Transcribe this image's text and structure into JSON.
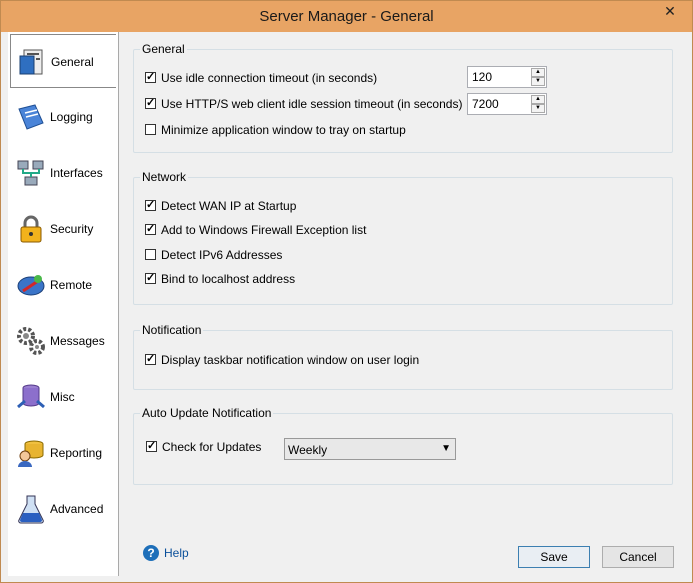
{
  "window": {
    "title": "Server Manager - General",
    "close_glyph": "✕"
  },
  "sidebar": {
    "items": [
      {
        "label": "General",
        "icon": "general-icon"
      },
      {
        "label": "Logging",
        "icon": "logging-icon"
      },
      {
        "label": "Interfaces",
        "icon": "interfaces-icon"
      },
      {
        "label": "Security",
        "icon": "lock-icon"
      },
      {
        "label": "Remote",
        "icon": "remote-icon"
      },
      {
        "label": "Messages",
        "icon": "gears-icon"
      },
      {
        "label": "Misc",
        "icon": "misc-icon"
      },
      {
        "label": "Reporting",
        "icon": "reporting-icon"
      },
      {
        "label": "Advanced",
        "icon": "flask-icon"
      }
    ],
    "active": "General"
  },
  "general": {
    "title": "General",
    "idle_timeout": {
      "label": "Use idle connection timeout (in seconds)",
      "checked": true,
      "value": "120"
    },
    "web_timeout": {
      "label": "Use HTTP/S web client idle session timeout (in seconds)",
      "checked": true,
      "value": "7200"
    },
    "minimize_tray": {
      "label": "Minimize application window to tray on startup",
      "checked": false
    }
  },
  "network": {
    "title": "Network",
    "items": [
      {
        "label": "Detect WAN IP at Startup",
        "checked": true
      },
      {
        "label": "Add to Windows Firewall Exception list",
        "checked": true
      },
      {
        "label": "Detect IPv6 Addresses",
        "checked": false
      },
      {
        "label": "Bind to localhost address",
        "checked": true
      }
    ]
  },
  "notification": {
    "title": "Notification",
    "display_taskbar": {
      "label": "Display taskbar notification window on user login",
      "checked": true
    }
  },
  "auto_update": {
    "title": "Auto Update Notification",
    "check_updates": {
      "label": "Check for Updates",
      "checked": true
    },
    "frequency": "Weekly"
  },
  "footer": {
    "help_label": "Help",
    "save_label": "Save",
    "cancel_label": "Cancel"
  },
  "colors": {
    "titlebar": "#e8a464",
    "accent": "#3c7fb1"
  }
}
